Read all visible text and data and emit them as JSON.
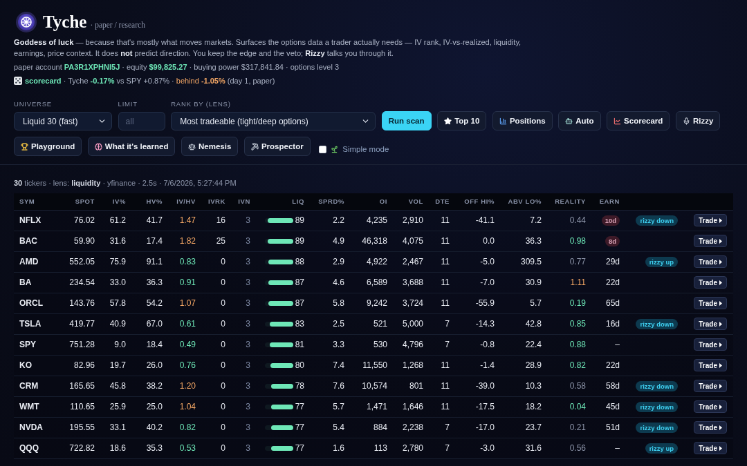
{
  "app": {
    "name": "Tyche",
    "subtitle": "· paper / research"
  },
  "intro": "**Goddess of luck** — because that's mostly what moves markets. Surfaces the options data a trader actually needs — IV rank, IV-vs-realized, liquidity, earnings, price context. It does **not** predict direction. You keep the edge and the veto; **Rizzy** talks you through it.",
  "account_line": [
    {
      "text": "paper account ",
      "color": "#aab2c4"
    },
    {
      "text": "**PA3R1XPHNI5J**",
      "color": "#6ee7b7"
    },
    {
      "text": " · equity ",
      "color": "#aab2c4"
    },
    {
      "text": "**$99,825.27**",
      "color": "#6ee7b7"
    },
    {
      "text": " · buying power $317,841.84 · options level 3",
      "color": "#aab2c4"
    }
  ],
  "scorecard_line": [
    {
      "text": "**scorecard**",
      "color": "#6ee7b7"
    },
    {
      "text": " · Tyche ",
      "color": "#aab2c4"
    },
    {
      "text": "**-0.17%**",
      "color": "#6ee7b7"
    },
    {
      "text": " vs SPY +0.87% · ",
      "color": "#aab2c4"
    },
    {
      "text": "behind **-1.05%**",
      "color": "#f4a765"
    },
    {
      "text": " (day 1, paper)",
      "color": "#aab2c4"
    }
  ],
  "controls": {
    "universe": {
      "label": "UNIVERSE",
      "value": "Liquid 30 (fast)"
    },
    "limit": {
      "label": "LIMIT",
      "placeholder": "all"
    },
    "lens": {
      "label": "RANK BY (LENS)",
      "value": "Most tradeable (tight/deep options)"
    },
    "buttons": [
      {
        "label": "Run scan",
        "kind": "primary"
      },
      {
        "label": "Top 10",
        "kind": "plain"
      },
      {
        "label": "Positions",
        "kind": "plain"
      },
      {
        "label": "Auto",
        "kind": "plain"
      },
      {
        "label": "Scorecard",
        "kind": "plain"
      },
      {
        "label": "Rizzy",
        "kind": "plain"
      },
      {
        "label": "Playground",
        "kind": "plain"
      },
      {
        "label": "What it's learned",
        "kind": "plain"
      },
      {
        "label": "Nemesis",
        "kind": "plain"
      },
      {
        "label": "Prospector",
        "kind": "plain"
      }
    ],
    "simple_mode": {
      "label": "Simple mode",
      "checked": false
    }
  },
  "scan_summary": "**30** tickers · lens: **liquidity** · yfinance · 2.5s · 7/6/2026, 5:27:44 PM",
  "table": {
    "columns": [
      "SYM",
      "SPOT",
      "IV%",
      "HV%",
      "IV/HV",
      "IVRK",
      "IVN",
      "LIQ",
      "SPRD%",
      "OI",
      "VOL",
      "DTE",
      "OFF HI%",
      "ABV LO%",
      "REALITY",
      "EARN"
    ],
    "rows": [
      {
        "sym": "NFLX",
        "spot": "76.02",
        "iv": "61.2",
        "hv": "41.7",
        "iv_hv": {
          "text": "1.47",
          "color": "#f4a765"
        },
        "ivrk": "16",
        "ivn": "3",
        "liq": "89",
        "level": 0.89,
        "sprd": "2.2",
        "oi": "4,235",
        "vol": "2,910",
        "dte": "11",
        "off_hi": "-41.1",
        "abv_lo": "7.2",
        "reality": {
          "text": "0.44",
          "color": "#8c94a8"
        },
        "earn": {
          "text": "10d",
          "soon": true
        },
        "signal": "rizzy down",
        "action": "Trade"
      },
      {
        "sym": "BAC",
        "spot": "59.90",
        "iv": "31.6",
        "hv": "17.4",
        "iv_hv": {
          "text": "1.82",
          "color": "#f4a765"
        },
        "ivrk": "25",
        "ivn": "3",
        "liq": "89",
        "level": 0.89,
        "sprd": "4.9",
        "oi": "46,318",
        "vol": "4,075",
        "dte": "11",
        "off_hi": "0.0",
        "abv_lo": "36.3",
        "reality": {
          "text": "0.98",
          "color": "#6ee7b7"
        },
        "earn": {
          "text": "8d",
          "soon": true
        },
        "action": "Trade"
      },
      {
        "sym": "AMD",
        "spot": "552.05",
        "iv": "75.9",
        "hv": "91.1",
        "iv_hv": {
          "text": "0.83",
          "color": "#6ee7b7"
        },
        "ivrk": "0",
        "ivn": "3",
        "liq": "88",
        "level": 0.88,
        "sprd": "2.9",
        "oi": "4,922",
        "vol": "2,467",
        "dte": "11",
        "off_hi": "-5.0",
        "abv_lo": "309.5",
        "reality": {
          "text": "0.77",
          "color": "#8c94a8"
        },
        "earn": {
          "text": "29d",
          "soon": false
        },
        "signal": "rizzy up",
        "action": "Trade"
      },
      {
        "sym": "BA",
        "spot": "234.54",
        "iv": "33.0",
        "hv": "36.3",
        "iv_hv": {
          "text": "0.91",
          "color": "#6ee7b7"
        },
        "ivrk": "0",
        "ivn": "3",
        "liq": "87",
        "level": 0.87,
        "sprd": "4.6",
        "oi": "6,589",
        "vol": "3,688",
        "dte": "11",
        "off_hi": "-7.0",
        "abv_lo": "30.9",
        "reality": {
          "text": "1.11",
          "color": "#f4a765"
        },
        "earn": {
          "text": "22d",
          "soon": false
        },
        "action": "Trade"
      },
      {
        "sym": "ORCL",
        "spot": "143.76",
        "iv": "57.8",
        "hv": "54.2",
        "iv_hv": {
          "text": "1.07",
          "color": "#f4a765"
        },
        "ivrk": "0",
        "ivn": "3",
        "liq": "87",
        "level": 0.87,
        "sprd": "5.8",
        "oi": "9,242",
        "vol": "3,724",
        "dte": "11",
        "off_hi": "-55.9",
        "abv_lo": "5.7",
        "reality": {
          "text": "0.19",
          "color": "#6ee7b7"
        },
        "earn": {
          "text": "65d",
          "soon": false
        },
        "action": "Trade"
      },
      {
        "sym": "TSLA",
        "spot": "419.77",
        "iv": "40.9",
        "hv": "67.0",
        "iv_hv": {
          "text": "0.61",
          "color": "#6ee7b7"
        },
        "ivrk": "0",
        "ivn": "3",
        "liq": "83",
        "level": 0.83,
        "sprd": "2.5",
        "oi": "521",
        "vol": "5,000",
        "dte": "7",
        "off_hi": "-14.3",
        "abv_lo": "42.8",
        "reality": {
          "text": "0.85",
          "color": "#6ee7b7"
        },
        "earn": {
          "text": "16d",
          "soon": false
        },
        "signal": "rizzy down",
        "action": "Trade"
      },
      {
        "sym": "SPY",
        "spot": "751.28",
        "iv": "9.0",
        "hv": "18.4",
        "iv_hv": {
          "text": "0.49",
          "color": "#6ee7b7"
        },
        "ivrk": "0",
        "ivn": "3",
        "liq": "81",
        "level": 0.81,
        "sprd": "3.3",
        "oi": "530",
        "vol": "4,796",
        "dte": "7",
        "off_hi": "-0.8",
        "abv_lo": "22.4",
        "reality": {
          "text": "0.88",
          "color": "#6ee7b7"
        },
        "earn": {
          "text": "–",
          "soon": false
        },
        "action": "Trade"
      },
      {
        "sym": "KO",
        "spot": "82.96",
        "iv": "19.7",
        "hv": "26.0",
        "iv_hv": {
          "text": "0.76",
          "color": "#6ee7b7"
        },
        "ivrk": "0",
        "ivn": "3",
        "liq": "80",
        "level": 0.8,
        "sprd": "7.4",
        "oi": "11,550",
        "vol": "1,268",
        "dte": "11",
        "off_hi": "-1.4",
        "abv_lo": "28.9",
        "reality": {
          "text": "0.82",
          "color": "#6ee7b7"
        },
        "earn": {
          "text": "22d",
          "soon": false
        },
        "action": "Trade"
      },
      {
        "sym": "CRM",
        "spot": "165.65",
        "iv": "45.8",
        "hv": "38.2",
        "iv_hv": {
          "text": "1.20",
          "color": "#f4a765"
        },
        "ivrk": "0",
        "ivn": "3",
        "liq": "78",
        "level": 0.78,
        "sprd": "7.6",
        "oi": "10,574",
        "vol": "801",
        "dte": "11",
        "off_hi": "-39.0",
        "abv_lo": "10.3",
        "reality": {
          "text": "0.58",
          "color": "#8c94a8"
        },
        "earn": {
          "text": "58d",
          "soon": false
        },
        "signal": "rizzy down",
        "action": "Trade"
      },
      {
        "sym": "WMT",
        "spot": "110.65",
        "iv": "25.9",
        "hv": "25.0",
        "iv_hv": {
          "text": "1.04",
          "color": "#f4a765"
        },
        "ivrk": "0",
        "ivn": "3",
        "liq": "77",
        "level": 0.77,
        "sprd": "5.7",
        "oi": "1,471",
        "vol": "1,646",
        "dte": "11",
        "off_hi": "-17.5",
        "abv_lo": "18.2",
        "reality": {
          "text": "0.04",
          "color": "#6ee7b7"
        },
        "earn": {
          "text": "45d",
          "soon": false
        },
        "signal": "rizzy down",
        "action": "Trade"
      },
      {
        "sym": "NVDA",
        "spot": "195.55",
        "iv": "33.1",
        "hv": "40.2",
        "iv_hv": {
          "text": "0.82",
          "color": "#6ee7b7"
        },
        "ivrk": "0",
        "ivn": "3",
        "liq": "77",
        "level": 0.77,
        "sprd": "5.4",
        "oi": "884",
        "vol": "2,238",
        "dte": "7",
        "off_hi": "-17.0",
        "abv_lo": "23.7",
        "reality": {
          "text": "0.21",
          "color": "#8c94a8"
        },
        "earn": {
          "text": "51d",
          "soon": false
        },
        "signal": "rizzy down",
        "action": "Trade"
      },
      {
        "sym": "QQQ",
        "spot": "722.82",
        "iv": "18.6",
        "hv": "35.3",
        "iv_hv": {
          "text": "0.53",
          "color": "#6ee7b7"
        },
        "ivrk": "0",
        "ivn": "3",
        "liq": "77",
        "level": 0.77,
        "sprd": "1.6",
        "oi": "113",
        "vol": "2,780",
        "dte": "7",
        "off_hi": "-3.0",
        "abv_lo": "31.6",
        "reality": {
          "text": "0.56",
          "color": "#8c94a8"
        },
        "earn": {
          "text": "–",
          "soon": false
        },
        "signal": "rizzy up",
        "action": "Trade"
      }
    ]
  }
}
